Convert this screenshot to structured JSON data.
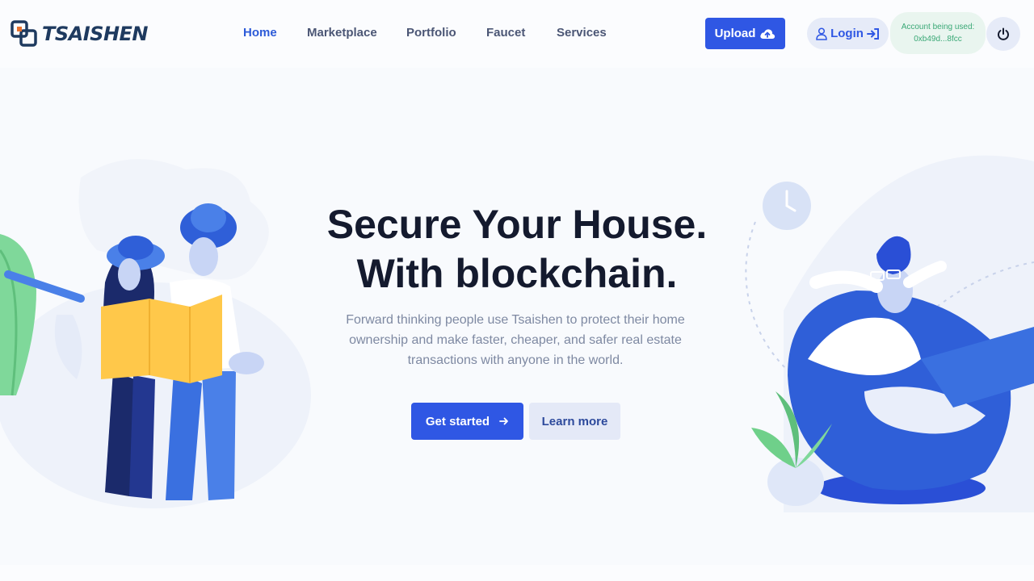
{
  "brand": {
    "name": "TSAISHEN"
  },
  "nav": {
    "items": [
      {
        "label": "Home",
        "active": true
      },
      {
        "label": "Marketplace",
        "active": false
      },
      {
        "label": "Portfolio",
        "active": false
      },
      {
        "label": "Faucet",
        "active": false
      },
      {
        "label": "Services",
        "active": false
      }
    ]
  },
  "header": {
    "upload_label": "Upload",
    "upload_icon": "cloud-upload-icon",
    "login_label": "Login",
    "login_icons": [
      "user-icon",
      "sign-in-icon"
    ],
    "account_label": "Account being used:",
    "account_value": "0xb49d...8fcc",
    "power_icon": "power-icon"
  },
  "hero": {
    "title_line1": "Secure Your House.",
    "title_line2": "With blockchain.",
    "subtitle": "Forward thinking people use Tsaishen to protect their home ownership and make faster, cheaper, and safer real estate transactions with anyone in the world.",
    "primary_cta": "Get started",
    "primary_cta_icon": "arrow-right-icon",
    "secondary_cta": "Learn more"
  },
  "colors": {
    "accent": "#2f57e4",
    "title": "#141a2e",
    "nav_text": "#4b5675",
    "nav_active": "#2d5bd8",
    "account_green": "#3aa876",
    "background": "#f8fafd"
  }
}
